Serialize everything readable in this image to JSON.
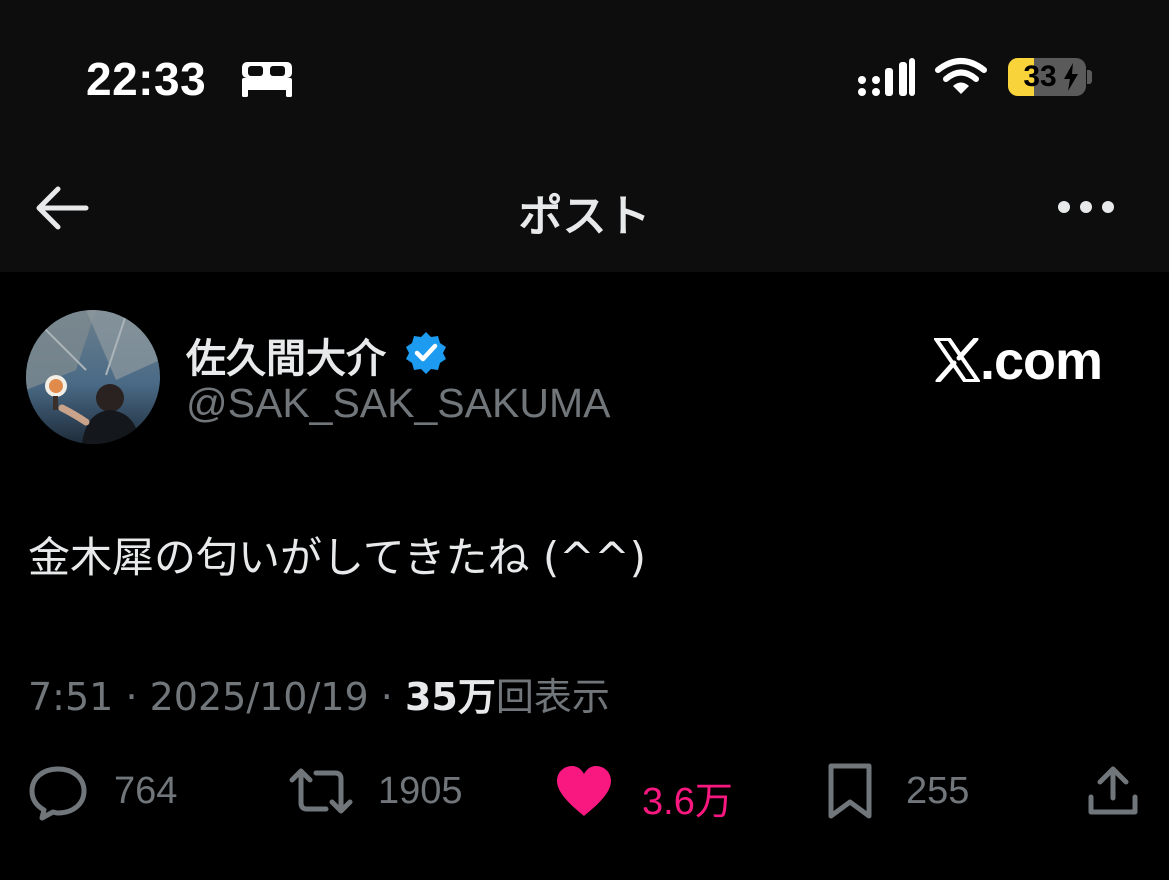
{
  "status_bar": {
    "time": "22:33",
    "battery_level": "33",
    "battery_fraction": 0.33,
    "focus_icon": "bed-icon",
    "signal_icon": "signal-icon",
    "wifi_icon": "wifi-icon"
  },
  "header": {
    "title": "ポスト",
    "back_icon": "arrow-left-icon",
    "more_icon": "more-horizontal-icon"
  },
  "post": {
    "author": {
      "display_name": "佐久間大介",
      "handle": "@SAK_SAK_SAKUMA",
      "verified": true
    },
    "watermark": "X.com",
    "watermark_text": ".com",
    "text": "金木犀の匂いがしてきたね (^^)",
    "time": "7:51",
    "date": "2025/10/19",
    "separator": "·",
    "views_count": "35万",
    "views_label": "回表示"
  },
  "actions": {
    "replies": "764",
    "reposts": "1905",
    "likes": "3.6万",
    "bookmarks": "255"
  },
  "colors": {
    "background": "#000000",
    "header_background": "#0d0d0d",
    "primary_text": "#e7e9ea",
    "secondary_text": "#71767b",
    "verified_blue": "#1d9bf0",
    "like_pink": "#f91880",
    "battery_yellow": "#f8d33a"
  }
}
